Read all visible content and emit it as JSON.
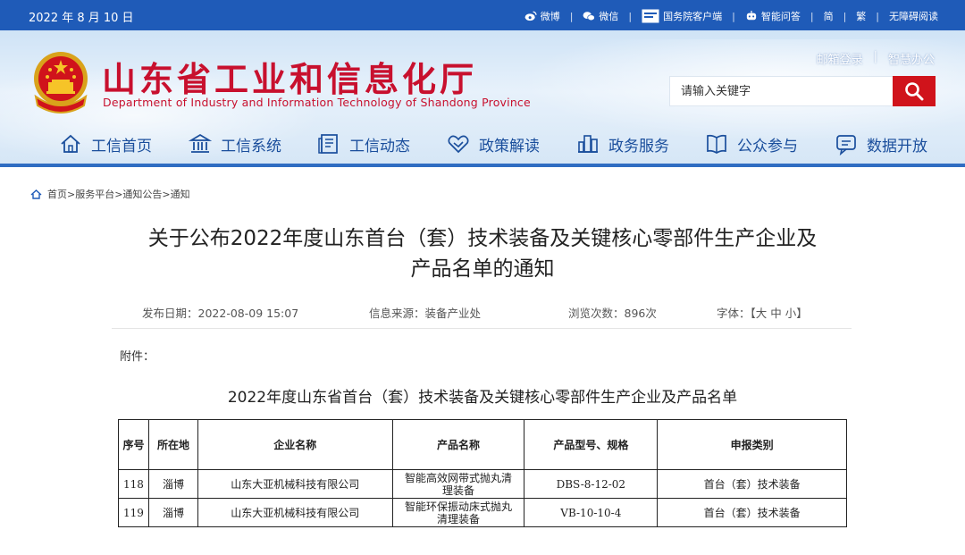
{
  "topbar": {
    "date": "2022 年 8 月 10 日",
    "links": [
      {
        "label": "微博",
        "icon": "weibo-icon"
      },
      {
        "label": "微信",
        "icon": "wechat-icon"
      },
      {
        "label": "国务院客户端",
        "icon": "gov-client-icon"
      },
      {
        "label": "智能问答",
        "icon": "robot-icon"
      },
      {
        "label": "简"
      },
      {
        "label": "繁"
      },
      {
        "label": "无障碍阅读"
      }
    ]
  },
  "header": {
    "site_title": "山东省工业和信息化厅",
    "site_subtitle": "Department of Industry and Information Technology of Shandong Province",
    "mail_login": "邮箱登录",
    "smart_office": "智慧办公",
    "search_placeholder": "请输入关键字",
    "brand_red": "#c8102e",
    "accent_blue": "#1f5bb8"
  },
  "nav": [
    {
      "label": "工信首页",
      "icon": "home-icon"
    },
    {
      "label": "工信系统",
      "icon": "building-icon"
    },
    {
      "label": "工信动态",
      "icon": "news-icon"
    },
    {
      "label": "政策解读",
      "icon": "handshake-icon"
    },
    {
      "label": "政务服务",
      "icon": "city-icon"
    },
    {
      "label": "公众参与",
      "icon": "book-icon"
    },
    {
      "label": "数据开放",
      "icon": "chat-icon"
    }
  ],
  "breadcrumb": "首页>服务平台>通知公告>通知",
  "article": {
    "title_line1": "关于公布2022年度山东首台（套）技术装备及关键核心零部件生产企业及",
    "title_line2": "产品名单的通知",
    "publish_label": "发布日期：",
    "publish_date": "2022-08-09 15:07",
    "source_label": "信息来源：",
    "source": "装备产业处",
    "views_label": "浏览次数：",
    "views": "896次",
    "font_label": "字体：",
    "font_sizes": "【大 中 小】",
    "attachment": "附件：",
    "list_title": "2022年度山东省首台（套）技术装备及关键核心零部件生产企业及产品名单"
  },
  "table": {
    "headers": [
      "序号",
      "所在地",
      "企业名称",
      "产品名称",
      "产品型号、规格",
      "申报类别"
    ],
    "rows": [
      {
        "no": "118",
        "location": "淄博",
        "company": "山东大亚机械科技有限公司",
        "product_l1": "智能高效网带式抛丸清",
        "product_l2": "理装备",
        "model": "DBS-8-12-02",
        "category": "首台（套）技术装备"
      },
      {
        "no": "119",
        "location": "淄博",
        "company": "山东大亚机械科技有限公司",
        "product_l1": "智能环保振动床式抛丸",
        "product_l2": "清理装备",
        "model": "VB-10-10-4",
        "category": "首台（套）技术装备"
      }
    ]
  }
}
